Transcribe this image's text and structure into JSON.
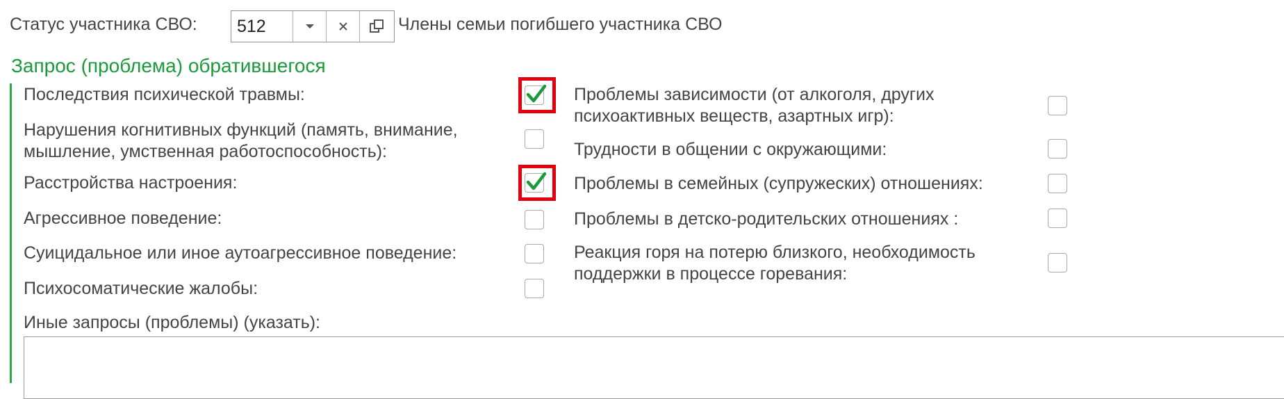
{
  "status": {
    "label": "Статус участника СВО:",
    "value": "512",
    "description": "Члены семьи погибшего участника СВО",
    "buttons": [
      "dropdown-icon",
      "clear-icon",
      "open-icon"
    ]
  },
  "section": {
    "title": "Запрос (проблема) обратившегося",
    "left_items": [
      {
        "label": "Последствия психической травмы:",
        "checked": true
      },
      {
        "label": "Нарушения когнитивных функций (память, внимание, мышление, умственная работоспособность):",
        "checked": false
      },
      {
        "label": "Расстройства настроения:",
        "checked": true
      },
      {
        "label": "Агрессивное поведение:",
        "checked": false
      },
      {
        "label": "Суицидальное или иное аутоагрессивное поведение:",
        "checked": false
      },
      {
        "label": "Психосоматические жалобы:",
        "checked": false
      }
    ],
    "right_items": [
      {
        "label": "Проблемы зависимости (от алкоголя, других психоактивных веществ, азартных игр):",
        "checked": false
      },
      {
        "label": "Трудности в общении с окружающими:",
        "checked": false
      },
      {
        "label": "Проблемы в семейных (супружеских) отношениях:",
        "checked": false
      },
      {
        "label": "Проблемы в детско-родительских отношениях :",
        "checked": false
      },
      {
        "label": "Реакция горя на потерю близкого, необходимость поддержки в процессе горевания:",
        "checked": false
      }
    ],
    "other_label": "Иные запросы (проблемы) (указать):",
    "other_value": ""
  },
  "colors": {
    "section_title": "#1a9a3a",
    "checkmark": "#1a9a3a",
    "highlight": "#e3000f"
  }
}
